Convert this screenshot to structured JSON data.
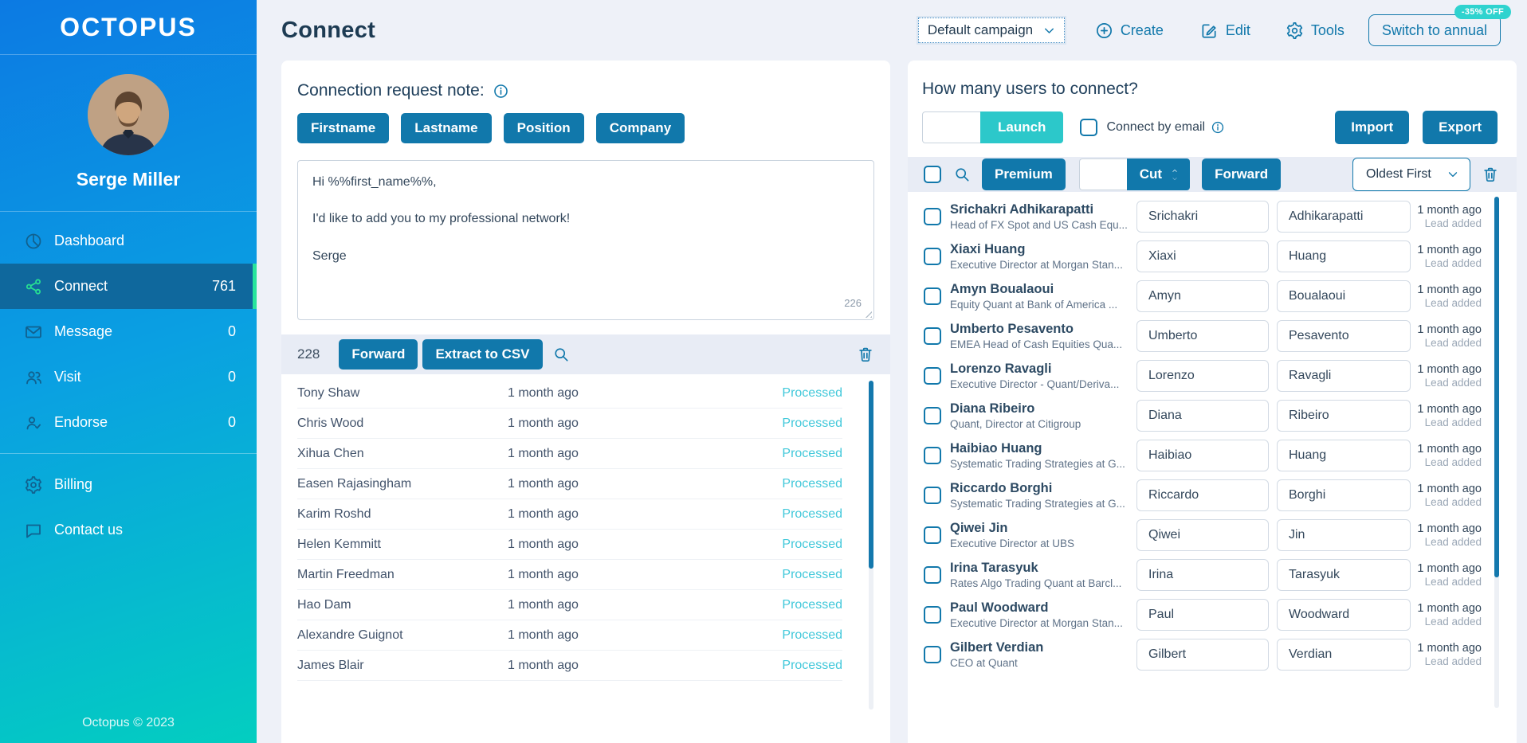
{
  "sidebar": {
    "logo": "OCTOPUS",
    "user_name": "Serge Miller",
    "items_primary": [
      {
        "label": "Dashboard",
        "icon": "dashboard"
      },
      {
        "label": "Connect",
        "icon": "share",
        "count": "761",
        "active": true
      },
      {
        "label": "Message",
        "icon": "envelope",
        "count": "0"
      },
      {
        "label": "Visit",
        "icon": "visit",
        "count": "0"
      },
      {
        "label": "Endorse",
        "icon": "endorse",
        "count": "0"
      }
    ],
    "items_secondary": [
      {
        "label": "Billing",
        "icon": "gear"
      },
      {
        "label": "Contact us",
        "icon": "chat"
      }
    ],
    "footer": "Octopus © 2023"
  },
  "header": {
    "title": "Connect",
    "campaign": "Default campaign",
    "create": "Create",
    "edit": "Edit",
    "tools": "Tools",
    "switch_annual": "Switch to annual",
    "discount": "-35% OFF"
  },
  "note_panel": {
    "heading": "Connection request note:",
    "tokens": [
      {
        "label": "Firstname"
      },
      {
        "label": "Lastname"
      },
      {
        "label": "Position"
      },
      {
        "label": "Company"
      }
    ],
    "message": "Hi %%first_name%%,\n\nI'd like to add you to my professional network!\n\nSerge",
    "char_count": "226",
    "queue_count": "228",
    "forward": "Forward",
    "extract": "Extract to CSV",
    "rows": [
      {
        "name": "Tony Shaw",
        "time": "1 month ago",
        "status": "Processed"
      },
      {
        "name": "Chris Wood",
        "time": "1 month ago",
        "status": "Processed"
      },
      {
        "name": "Xihua Chen",
        "time": "1 month ago",
        "status": "Processed"
      },
      {
        "name": "Easen Rajasingham",
        "time": "1 month ago",
        "status": "Processed"
      },
      {
        "name": "Karim Roshd",
        "time": "1 month ago",
        "status": "Processed"
      },
      {
        "name": "Helen Kemmitt",
        "time": "1 month ago",
        "status": "Processed"
      },
      {
        "name": "Martin Freedman",
        "time": "1 month ago",
        "status": "Processed"
      },
      {
        "name": "Hao Dam",
        "time": "1 month ago",
        "status": "Processed"
      },
      {
        "name": "Alexandre Guignot",
        "time": "1 month ago",
        "status": "Processed"
      },
      {
        "name": "James Blair",
        "time": "1 month ago",
        "status": "Processed"
      }
    ]
  },
  "connect_panel": {
    "heading": "How many users to connect?",
    "launch_value": "",
    "launch": "Launch",
    "connect_by_email": "Connect by email",
    "import": "Import",
    "export": "Export",
    "premium": "Premium",
    "cut_value": "",
    "cut": "Cut",
    "forward": "Forward",
    "sort": "Oldest First",
    "users": [
      {
        "name": "Srichakri Adhikarapatti",
        "title": "Head of FX Spot and US Cash Equ...",
        "first": "Srichakri",
        "last": "Adhikarapatti",
        "time": "1 month ago",
        "status": "Lead added"
      },
      {
        "name": "Xiaxi Huang",
        "title": "Executive Director at Morgan Stan...",
        "first": "Xiaxi",
        "last": "Huang",
        "time": "1 month ago",
        "status": "Lead added"
      },
      {
        "name": "Amyn Boualaoui",
        "title": "Equity Quant at Bank of America ...",
        "first": "Amyn",
        "last": "Boualaoui",
        "time": "1 month ago",
        "status": "Lead added"
      },
      {
        "name": "Umberto Pesavento",
        "title": "EMEA Head of Cash Equities Qua...",
        "first": "Umberto",
        "last": "Pesavento",
        "time": "1 month ago",
        "status": "Lead added"
      },
      {
        "name": "Lorenzo Ravagli",
        "title": "Executive Director - Quant/Deriva...",
        "first": "Lorenzo",
        "last": "Ravagli",
        "time": "1 month ago",
        "status": "Lead added"
      },
      {
        "name": "Diana Ribeiro",
        "title": "Quant, Director at Citigroup",
        "first": "Diana",
        "last": "Ribeiro",
        "time": "1 month ago",
        "status": "Lead added"
      },
      {
        "name": "Haibiao Huang",
        "title": "Systematic Trading Strategies at G...",
        "first": "Haibiao",
        "last": "Huang",
        "time": "1 month ago",
        "status": "Lead added"
      },
      {
        "name": "Riccardo Borghi",
        "title": "Systematic Trading Strategies at G...",
        "first": "Riccardo",
        "last": "Borghi",
        "time": "1 month ago",
        "status": "Lead added"
      },
      {
        "name": "Qiwei Jin",
        "title": "Executive Director at UBS",
        "first": "Qiwei",
        "last": "Jin",
        "time": "1 month ago",
        "status": "Lead added"
      },
      {
        "name": "Irina Tarasyuk",
        "title": "Rates Algo Trading Quant at Barcl...",
        "first": "Irina",
        "last": "Tarasyuk",
        "time": "1 month ago",
        "status": "Lead added"
      },
      {
        "name": "Paul Woodward",
        "title": "Executive Director at Morgan Stan...",
        "first": "Paul",
        "last": "Woodward",
        "time": "1 month ago",
        "status": "Lead added"
      },
      {
        "name": "Gilbert Verdian",
        "title": "CEO at Quant",
        "first": "Gilbert",
        "last": "Verdian",
        "time": "1 month ago",
        "status": "Lead added"
      }
    ]
  },
  "colors": {
    "accent_blue": "#1178ab",
    "teal_button": "#2cc8ca",
    "badge_teal": "#2fd3cf",
    "processed_cyan": "#41c8da",
    "active_green": "#27e49d",
    "sidebar_gradient_top": "#0c7ae3",
    "sidebar_gradient_bottom": "#03cec0",
    "page_background": "#eef1f8",
    "toolbar_background": "#e8ecf5"
  }
}
